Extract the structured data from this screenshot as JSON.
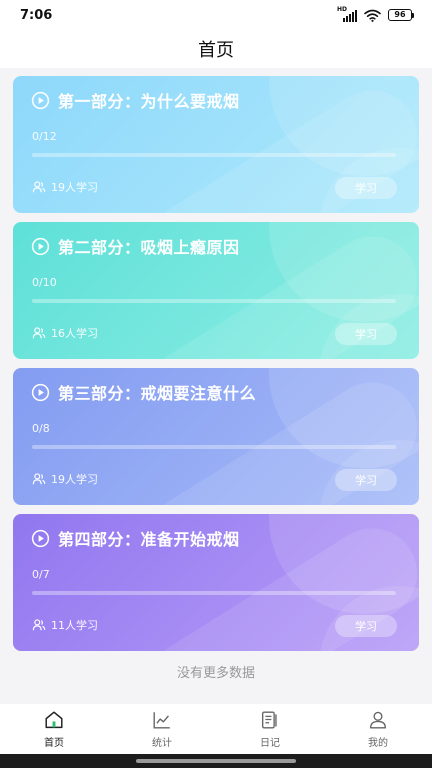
{
  "status_bar": {
    "time": "7:06",
    "network_badge": "HD",
    "battery_level": "96"
  },
  "header": {
    "title": "首页"
  },
  "courses": [
    {
      "title": "第一部分：为什么要戒烟",
      "progress_text": "0/12",
      "progress": 0,
      "learners": "19人学习",
      "button_label": "学习",
      "gradient": [
        "#8ed8fb",
        "#aee9fb"
      ]
    },
    {
      "title": "第二部分：吸烟上瘾原因",
      "progress_text": "0/10",
      "progress": 0,
      "learners": "16人学习",
      "button_label": "学习",
      "gradient": [
        "#5ee0d8",
        "#8eeee3"
      ]
    },
    {
      "title": "第三部分：戒烟要注意什么",
      "progress_text": "0/8",
      "progress": 0,
      "learners": "19人学习",
      "button_label": "学习",
      "gradient": [
        "#849cf1",
        "#a6bbf8"
      ]
    },
    {
      "title": "第四部分：准备开始戒烟",
      "progress_text": "0/7",
      "progress": 0,
      "learners": "11人学习",
      "button_label": "学习",
      "gradient": [
        "#9177ef",
        "#b79df7"
      ]
    }
  ],
  "list_footer": "没有更多数据",
  "tab_bar": {
    "tabs": [
      {
        "label": "首页",
        "icon": "home-icon",
        "active": true
      },
      {
        "label": "统计",
        "icon": "chart-icon",
        "active": false
      },
      {
        "label": "日记",
        "icon": "diary-icon",
        "active": false
      },
      {
        "label": "我的",
        "icon": "profile-icon",
        "active": false
      }
    ]
  },
  "colors": {
    "page_background": "#f4f4f6",
    "active_icon_accent": "#2fbf71"
  }
}
